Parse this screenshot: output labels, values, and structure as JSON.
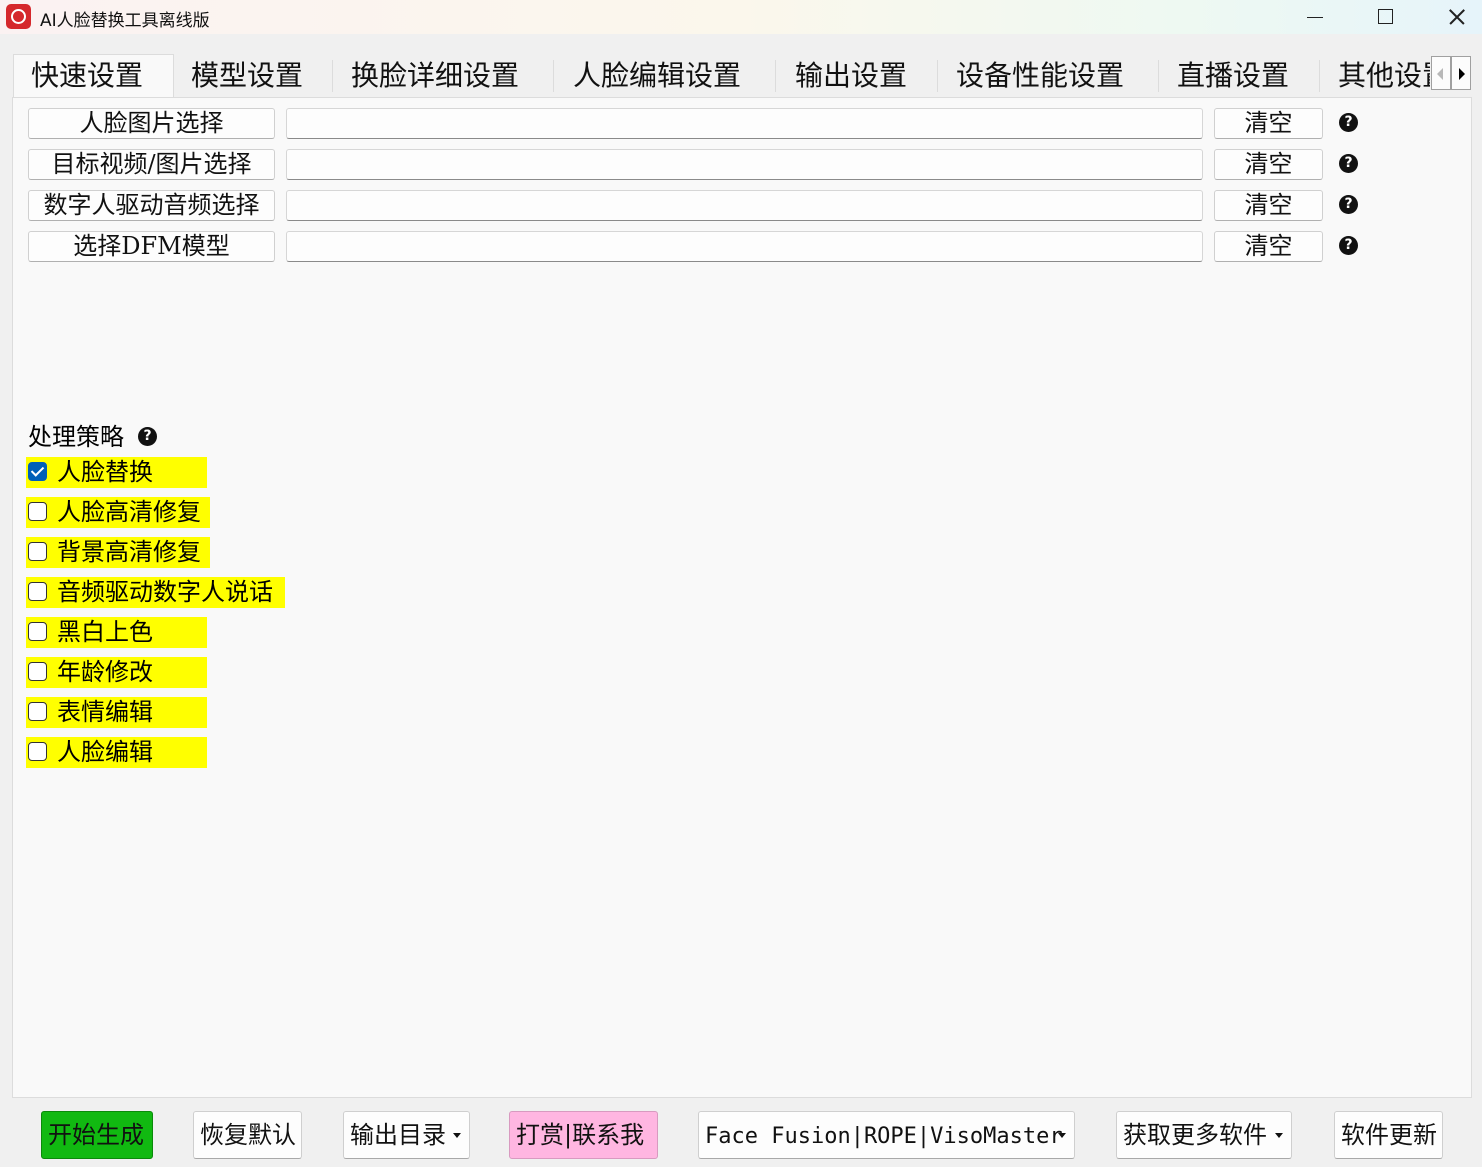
{
  "window": {
    "title": "AI人脸替换工具离线版",
    "icon": "rose-logo-icon",
    "controls": [
      "minimize-icon",
      "maximize-icon",
      "close-icon"
    ]
  },
  "tabs": [
    {
      "label": "快速设置",
      "active": true
    },
    {
      "label": "模型设置"
    },
    {
      "label": "换脸详细设置"
    },
    {
      "label": "人脸编辑设置"
    },
    {
      "label": "输出设置"
    },
    {
      "label": "设备性能设置"
    },
    {
      "label": "直播设置"
    },
    {
      "label": "其他设置"
    }
  ],
  "file_rows": [
    {
      "button": "人脸图片选择",
      "value": "",
      "clear": "清空"
    },
    {
      "button": "目标视频/图片选择",
      "value": "",
      "clear": "清空"
    },
    {
      "button": "数字人驱动音频选择",
      "value": "",
      "clear": "清空"
    },
    {
      "button": "选择DFM模型",
      "value": "",
      "clear": "清空"
    }
  ],
  "strategy": {
    "label": "处理策略",
    "highlight_color": "#ffff00",
    "options": [
      {
        "label": "人脸替换",
        "checked": true
      },
      {
        "label": "人脸高清修复",
        "checked": false
      },
      {
        "label": "背景高清修复",
        "checked": false
      },
      {
        "label": "音频驱动数字人说话",
        "checked": false
      },
      {
        "label": "黑白上色",
        "checked": false
      },
      {
        "label": "年龄修改",
        "checked": false
      },
      {
        "label": "表情编辑",
        "checked": false
      },
      {
        "label": "人脸编辑",
        "checked": false
      }
    ]
  },
  "bottom": {
    "start": "开始生成",
    "reset": "恢复默认",
    "output_dir": "输出目录",
    "donate": "打赏|联系我",
    "links": "Face Fusion|ROPE|VisoMaster",
    "more": "获取更多软件",
    "update": "软件更新"
  },
  "colors": {
    "start_button": "#11b911",
    "donate_button": "#ffb6e1",
    "checkbox_accent": "#005fb8"
  }
}
